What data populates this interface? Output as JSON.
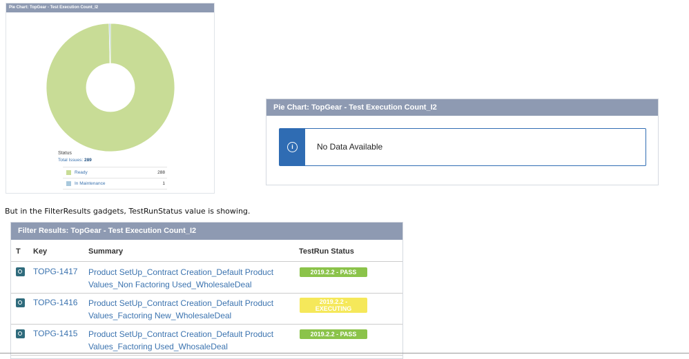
{
  "gadget1": {
    "title": "Pie Chart: TopGear - Test Execution Count_I2",
    "status_label": "Status",
    "total_label": "Total Issues:",
    "total_value": "289",
    "legend": [
      {
        "label": "Ready",
        "count": "288",
        "color": "#c8dc96"
      },
      {
        "label": "In Maintenance",
        "count": "1",
        "color": "#a8c8dc"
      }
    ]
  },
  "chart_data": {
    "type": "pie",
    "categories": [
      "Ready",
      "In Maintenance"
    ],
    "values": [
      288,
      1
    ],
    "title": "Pie Chart: TopGear - Test Execution Count_I2",
    "colors": [
      "#c8dc96",
      "#a8c8dc"
    ]
  },
  "gadget2": {
    "title": "Pie Chart: TopGear - Test Execution Count_I2",
    "message": "No Data Available"
  },
  "caption": "But in the FilterResults gadgets, TestRunStatus value is showing.",
  "gadget3": {
    "title": "Filter Results: TopGear - Test Execution Count_I2",
    "columns": {
      "t": "T",
      "key": "Key",
      "summary": "Summary",
      "status": "TestRun Status"
    },
    "rows": [
      {
        "key": "TOPG-1417",
        "summary_1": "Product SetUp_Contract Creation_Default Product",
        "summary_2": "Values_Non Factoring Used_WholesaleDeal",
        "status_1": "2019.2.2 - PASS",
        "status_2": ""
      },
      {
        "key": "TOPG-1416",
        "summary_1": "Product SetUp_Contract Creation_Default Product",
        "summary_2": "Values_Factoring New_WholesaleDeal",
        "status_1": "2019.2.2 -",
        "status_2": "EXECUTING"
      },
      {
        "key": "TOPG-1415",
        "summary_1": "Product SetUp_Contract Creation_Default Product",
        "summary_2": "Values_Factoring Used_WhosaleDeal",
        "status_1": "2019.2.2 - PASS",
        "status_2": ""
      }
    ]
  }
}
